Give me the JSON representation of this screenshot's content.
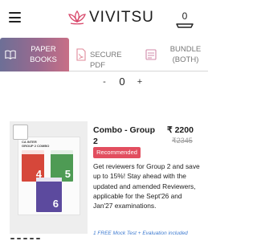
{
  "header": {
    "menu_icon": "hamburger-menu-icon",
    "brand": "VIVITSU",
    "brand_logo_icon": "lotus-logo-icon",
    "brand_color": "#d8486b",
    "cart_icon": "shopping-bag-icon",
    "cart_count": "0"
  },
  "tabs": [
    {
      "label": "PAPER BOOKS",
      "icon": "open-book-icon",
      "active": true
    },
    {
      "label": "SECURE PDF",
      "icon": "pdf-file-icon",
      "active": false
    },
    {
      "label": "BUNDLE (BOTH)",
      "icon": "bundle-box-icon",
      "active": false
    }
  ],
  "quantity": {
    "minus": "-",
    "value": "0",
    "plus": "+"
  },
  "product": {
    "title": "Combo - Group 2",
    "price": "₹ 2200",
    "old_price": "₹2345",
    "badge": "Recommended",
    "badge_color": "#e24e5f",
    "description": "Get reviewers for Group 2 and save up to 15%! Stay ahead with the updated and amended Reviewers, applicable for the Sept'26 and Jan'27 examinations.",
    "note": "1 FREE Mock Test + Evaluation included",
    "note_color": "#3e7bd0",
    "cover": {
      "heading": "CA INTER\nGROUP 2 COMBO",
      "book_numbers": [
        "4",
        "5",
        "6"
      ]
    }
  }
}
